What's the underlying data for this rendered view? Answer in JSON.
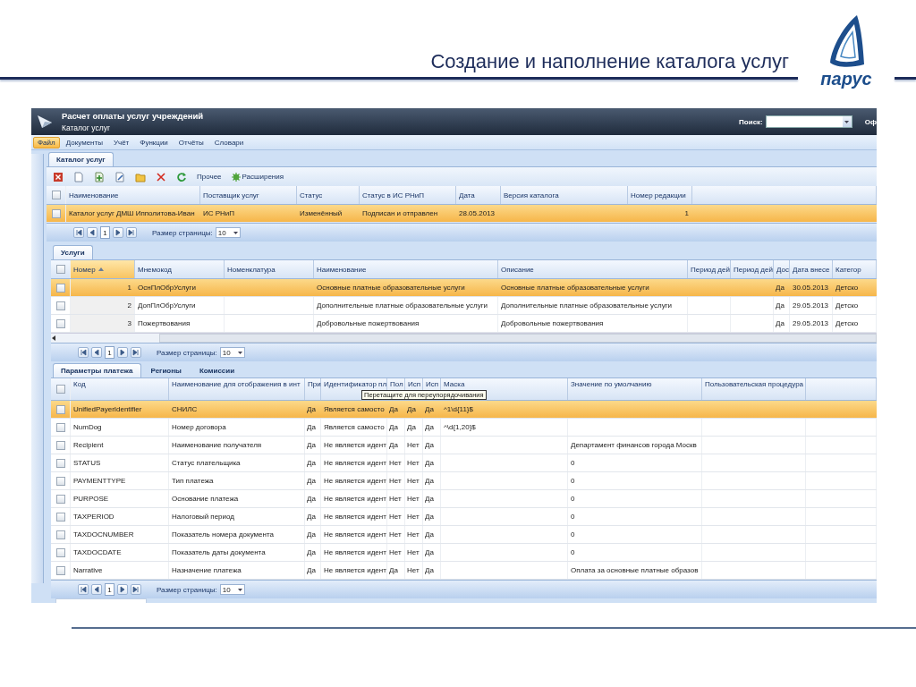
{
  "slide": {
    "title": "Создание и наполнение каталога услуг",
    "logo_text": "парус"
  },
  "app": {
    "title": "Расчет оплаты услуг учреждений",
    "subtitle": "Каталог услуг",
    "search_label": "Поиск:",
    "cut_label": "Оф",
    "menu": [
      {
        "label": "Файл",
        "selected": true
      },
      {
        "label": "Документы",
        "selected": false
      },
      {
        "label": "Учёт",
        "selected": false
      },
      {
        "label": "Функции",
        "selected": false
      },
      {
        "label": "Отчёты",
        "selected": false
      },
      {
        "label": "Словари",
        "selected": false
      }
    ],
    "main_tabs": [
      {
        "label": "Каталог услуг",
        "selected": true
      }
    ],
    "toolbar": {
      "text_buttons": [
        {
          "label": "Прочее",
          "kind": "plain"
        },
        {
          "label": "Расширения",
          "kind": "gear"
        }
      ]
    },
    "catalog_grid": {
      "all_checked": false,
      "columns": [
        {
          "label": "Наименование"
        },
        {
          "label": "Поставщик услуг"
        },
        {
          "label": "Статус"
        },
        {
          "label": "Статус в ИС РНиП"
        },
        {
          "label": "Дата"
        },
        {
          "label": "Версия каталога"
        },
        {
          "label": "Номер редакции"
        }
      ],
      "rows": [
        {
          "checked": false,
          "selected": true,
          "cells": [
            "Каталог услуг ДМШ Ипполитова-Иван",
            "ИС РНиП",
            "Изменённый",
            "Подписан и отправлен",
            "28.05.2013",
            null,
            "1"
          ]
        }
      ],
      "pager": {
        "page": "1",
        "size_label": "Размер страницы:",
        "size": "10"
      }
    },
    "services_tabs": [
      {
        "label": "Услуги",
        "selected": true
      }
    ],
    "services_grid": {
      "all_checked": false,
      "columns": [
        {
          "label": "Номер",
          "sorted": true
        },
        {
          "label": "Мнемокод"
        },
        {
          "label": "Номенклатура"
        },
        {
          "label": "Наименование"
        },
        {
          "label": "Описание"
        },
        {
          "label": "Период дей"
        },
        {
          "label": "Период дей"
        },
        {
          "label": "Дос"
        },
        {
          "label": "Дата внесе"
        },
        {
          "label": "Категор"
        }
      ],
      "rows": [
        {
          "checked": false,
          "selected": true,
          "cells": [
            "1",
            "ОснПлОбрУслуги",
            null,
            "Основные платные образовательные услуги",
            "Основные платные образовательные услуги",
            null,
            null,
            "Да",
            "30.05.2013",
            "Детско"
          ]
        },
        {
          "checked": false,
          "selected": false,
          "cells": [
            "2",
            "ДопПлОбрУслуги",
            null,
            "Дополнительные платные образовательные услуги",
            "Дополнительные платные образовательные услуги",
            null,
            null,
            "Да",
            "29.05.2013",
            "Детско"
          ]
        },
        {
          "checked": false,
          "selected": false,
          "cells": [
            "3",
            "Пожертвования",
            null,
            "Добровольные пожертвования",
            "Добровольные пожертвования",
            null,
            null,
            "Да",
            "29.05.2013",
            "Детско"
          ]
        }
      ],
      "pager": {
        "page": "1",
        "size_label": "Размер страницы:",
        "size": "10"
      }
    },
    "detail_tabs": [
      {
        "label": "Параметры платежа",
        "selected": true
      },
      {
        "label": "Регионы",
        "selected": false
      },
      {
        "label": "Комиссии",
        "selected": false
      }
    ],
    "detail_grid": {
      "all_checked": false,
      "tooltip": "Перетащите для переупорядочивания",
      "columns": [
        {
          "label": "Код"
        },
        {
          "label": "Наименование для отображения в инт"
        },
        {
          "label": "При"
        },
        {
          "label": "Идентификатор пл"
        },
        {
          "label": "Пол"
        },
        {
          "label": "Исп"
        },
        {
          "label": "Исп"
        },
        {
          "label": "Маска"
        },
        {
          "label": "Значение по умолчанию"
        },
        {
          "label": "Пользовательская процедура"
        }
      ],
      "rows": [
        {
          "checked": false,
          "selected": true,
          "cells": [
            "UnifiedPayerIdentifier",
            "СНИЛС",
            "Да",
            "Является самосто",
            "Да",
            "Да",
            "Да",
            "^1\\d{11}$",
            null,
            null
          ]
        },
        {
          "checked": false,
          "selected": false,
          "cells": [
            "NumDog",
            "Номер договора",
            "Да",
            "Является самосто",
            "Да",
            "Да",
            "Да",
            "^\\d{1,20}$",
            null,
            null
          ]
        },
        {
          "checked": false,
          "selected": false,
          "cells": [
            "Recipient",
            "Наименование получателя",
            "Да",
            "Не является идент",
            "Да",
            "Нет",
            "Да",
            null,
            "Департамент финансов города Москв",
            null
          ]
        },
        {
          "checked": false,
          "selected": false,
          "cells": [
            "STATUS",
            "Статус плательщика",
            "Да",
            "Не является идент",
            "Нет",
            "Нет",
            "Да",
            null,
            "0",
            null
          ]
        },
        {
          "checked": false,
          "selected": false,
          "cells": [
            "PAYMENTTYPE",
            "Тип платежа",
            "Да",
            "Не является идент",
            "Нет",
            "Нет",
            "Да",
            null,
            "0",
            null
          ]
        },
        {
          "checked": false,
          "selected": false,
          "cells": [
            "PURPOSE",
            "Основание платежа",
            "Да",
            "Не является идент",
            "Нет",
            "Нет",
            "Да",
            null,
            "0",
            null
          ]
        },
        {
          "checked": false,
          "selected": false,
          "cells": [
            "TAXPERIOD",
            "Налоговый период",
            "Да",
            "Не является идент",
            "Нет",
            "Нет",
            "Да",
            null,
            "0",
            null
          ]
        },
        {
          "checked": false,
          "selected": false,
          "cells": [
            "TAXDOCNUMBER",
            "Показатель номера документа",
            "Да",
            "Не является идент",
            "Нет",
            "Нет",
            "Да",
            null,
            "0",
            null
          ]
        },
        {
          "checked": false,
          "selected": false,
          "cells": [
            "TAXDOCDATE",
            "Показатель даты документа",
            "Да",
            "Не является идент",
            "Нет",
            "Нет",
            "Да",
            null,
            "0",
            null
          ]
        },
        {
          "checked": false,
          "selected": false,
          "cells": [
            "Narrative",
            "Назначение платежа",
            "Да",
            "Не является идент",
            "Да",
            "Нет",
            "Да",
            null,
            "Оплата за основные платные образов",
            null
          ]
        }
      ],
      "pager": {
        "page": "1",
        "size_label": "Размер страницы:",
        "size": "10"
      }
    }
  }
}
